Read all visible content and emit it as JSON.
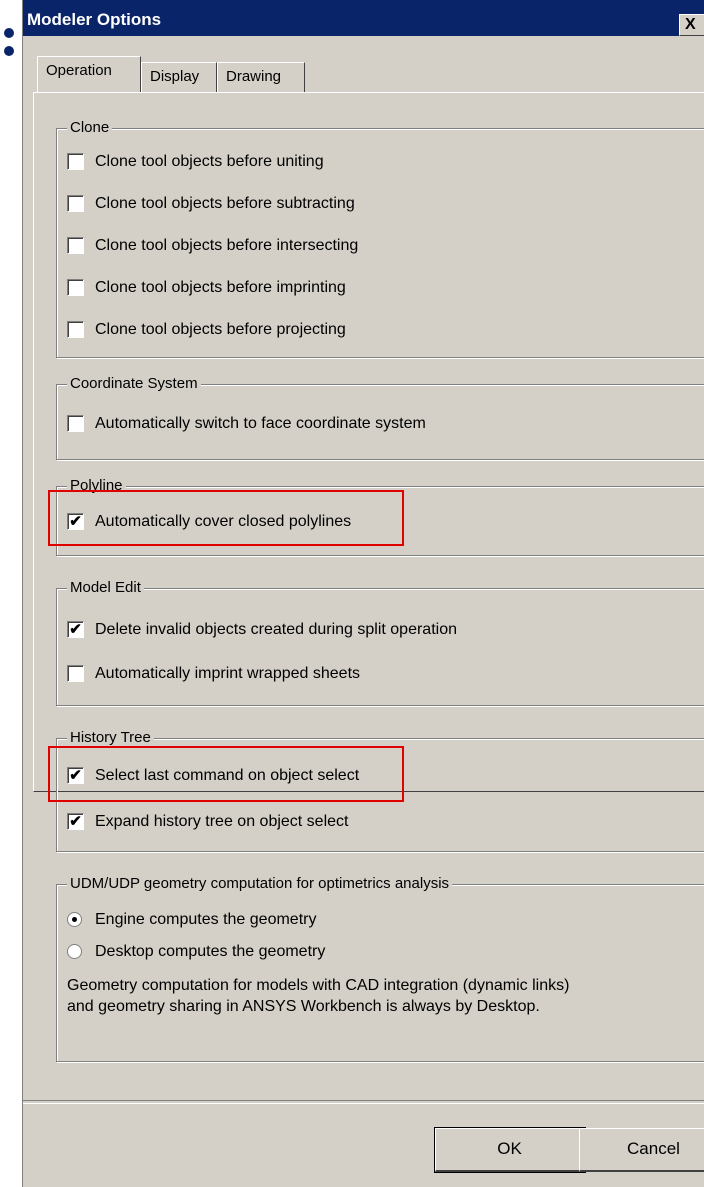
{
  "window": {
    "title": "Modeler Options",
    "close_label": "X"
  },
  "tabs": [
    {
      "label": "Operation",
      "active": true
    },
    {
      "label": "Display",
      "active": false
    },
    {
      "label": "Drawing",
      "active": false
    }
  ],
  "groups": {
    "clone": {
      "title": "Clone",
      "items": [
        {
          "label": "Clone tool objects before uniting",
          "checked": false
        },
        {
          "label": "Clone tool objects before subtracting",
          "checked": false
        },
        {
          "label": "Clone tool objects before intersecting",
          "checked": false
        },
        {
          "label": "Clone tool objects before imprinting",
          "checked": false
        },
        {
          "label": "Clone tool objects before projecting",
          "checked": false
        }
      ]
    },
    "coordinate": {
      "title": "Coordinate System",
      "items": [
        {
          "label": "Automatically switch to face coordinate system",
          "checked": false
        }
      ]
    },
    "polyline": {
      "title": "Polyline",
      "items": [
        {
          "label": "Automatically cover closed polylines",
          "checked": true
        }
      ]
    },
    "model_edit": {
      "title": "Model Edit",
      "items": [
        {
          "label": "Delete invalid objects created during split operation",
          "checked": true
        },
        {
          "label": "Automatically imprint wrapped sheets",
          "checked": false
        }
      ]
    },
    "history": {
      "title": "History Tree",
      "items": [
        {
          "label": "Select last command on object select",
          "checked": true
        },
        {
          "label": "Expand history tree on object select",
          "checked": true
        }
      ]
    },
    "udm": {
      "title": "UDM/UDP geometry computation for optimetrics analysis",
      "options": [
        {
          "label": "Engine computes the geometry",
          "selected": true
        },
        {
          "label": "Desktop computes the geometry",
          "selected": false
        }
      ],
      "note_line1": "Geometry computation for models with CAD integration (dynamic links)",
      "note_line2": "and geometry sharing in ANSYS Workbench is always by Desktop."
    }
  },
  "buttons": {
    "ok": "OK",
    "cancel": "Cancel"
  },
  "colors": {
    "highlight": "#e00000",
    "titlebar": "#0a246a",
    "dialog_bg": "#d4d0c8"
  }
}
